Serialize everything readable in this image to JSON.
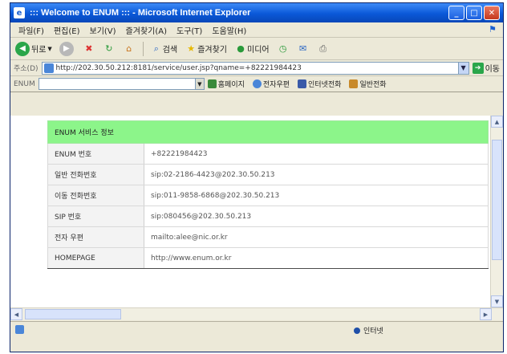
{
  "window": {
    "title": "::: Welcome to ENUM ::: - Microsoft Internet Explorer",
    "icon": "ie-icon"
  },
  "menu": {
    "items": [
      "파일(F)",
      "편집(E)",
      "보기(V)",
      "즐겨찾기(A)",
      "도구(T)",
      "도움말(H)"
    ]
  },
  "toolbar": {
    "back": "뒤로",
    "search": "검색",
    "favorites": "즐겨찾기",
    "media": "미디어"
  },
  "address": {
    "label": "주소(D)",
    "url": "http://202.30.50.212:8181/service/user.jsp?qname=+82221984423",
    "go": "이동"
  },
  "links": {
    "label": "ENUM",
    "items": [
      "홈페이지",
      "전자우편",
      "인터넷전화",
      "일반전화"
    ]
  },
  "table": {
    "header": "ENUM 서비스 정보",
    "rows": [
      {
        "label": "ENUM 번호",
        "value": "+82221984423"
      },
      {
        "label": "일반 전화번호",
        "value": "sip:02-2186-4423@202.30.50.213"
      },
      {
        "label": "이동 전화번호",
        "value": "sip:011-9858-6868@202.30.50.213"
      },
      {
        "label": "SIP 번호",
        "value": "sip:080456@202.30.50.213"
      },
      {
        "label": "전자 우편",
        "value": "mailto:alee@nic.or.kr"
      },
      {
        "label": "HOMEPAGE",
        "value": "http://www.enum.or.kr"
      }
    ]
  },
  "status": {
    "zone": "인터넷"
  }
}
